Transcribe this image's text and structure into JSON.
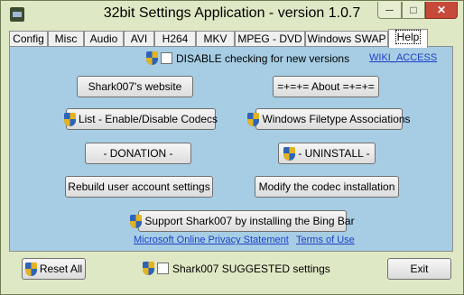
{
  "window": {
    "title": "32bit Settings Application - version 1.0.7",
    "controls": {
      "minimize": "─",
      "maximize": "□",
      "close": "✕"
    }
  },
  "tabs": [
    {
      "label": "Config"
    },
    {
      "label": "Misc"
    },
    {
      "label": "Audio"
    },
    {
      "label": "AVI"
    },
    {
      "label": "H264"
    },
    {
      "label": "MKV"
    },
    {
      "label": "MPEG - DVD"
    },
    {
      "label": "Windows SWAP"
    },
    {
      "label": "Help",
      "active": true
    }
  ],
  "help": {
    "disable_check_label": "DISABLE checking for new versions",
    "wiki_link": "WIKI_ACCESS",
    "website_button": "Shark007's website",
    "about_button": "=+=+= About =+=+=",
    "codecs_button": "List - Enable/Disable Codecs",
    "filetype_button": "Windows Filetype Associations",
    "donation_button": "- DONATION -",
    "uninstall_button": "- UNINSTALL -",
    "rebuild_button": "Rebuild user account settings",
    "modify_button": "Modify the codec installation",
    "bing_button": "Support Shark007 by installing the Bing Bar",
    "privacy_link": "Microsoft Online Privacy Statement",
    "terms_link": "Terms of Use"
  },
  "footer": {
    "reset_button": "Reset All",
    "suggested_label": "Shark007 SUGGESTED settings",
    "exit_button": "Exit"
  },
  "colors": {
    "panel": "#a6cde3",
    "frame": "#dfe8c4",
    "link": "#1f3fc8"
  }
}
